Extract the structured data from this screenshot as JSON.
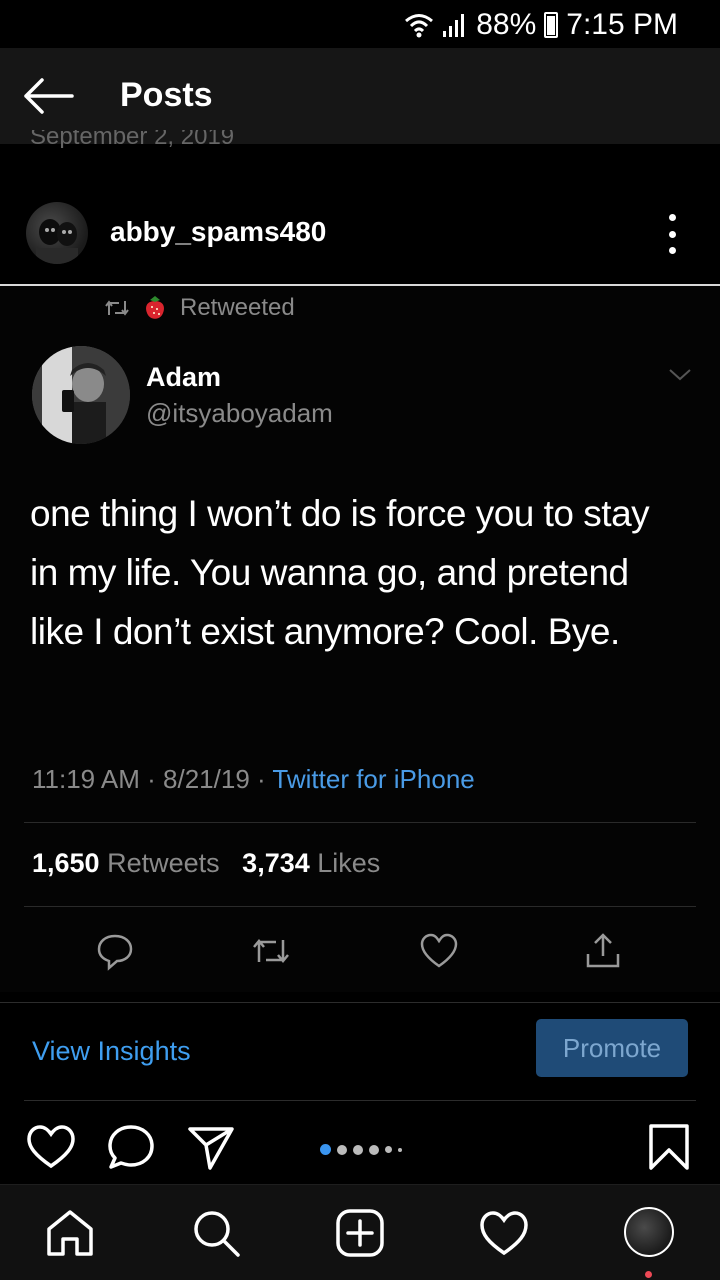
{
  "status_bar": {
    "battery": "88%",
    "time": "7:15 PM"
  },
  "header": {
    "title": "Posts"
  },
  "date_peek": "September 2, 2019",
  "post": {
    "username": "abby_spams480"
  },
  "tweet": {
    "retweet_label": "Retweeted",
    "name": "Adam",
    "handle": "@itsyaboyadam",
    "text": "one thing I won’t do is force you to stay in my life. You wanna go, and pretend like I don’t exist anymore? Cool. Bye.",
    "time_date": "11:19 AM · 8/21/19 · ",
    "source": "Twitter for iPhone",
    "retweets_count": "1,650",
    "retweets_label": "Retweets",
    "likes_count": "3,734",
    "likes_label": "Likes"
  },
  "insights": {
    "view_label": "View Insights",
    "promote_label": "Promote"
  },
  "carousel": {
    "current": 1,
    "count": 6
  },
  "colors": {
    "link_blue": "#3f9ef0",
    "promote_bg": "#1f4b77",
    "carousel_active": "#3a95f0",
    "notification": "#ed4956"
  }
}
